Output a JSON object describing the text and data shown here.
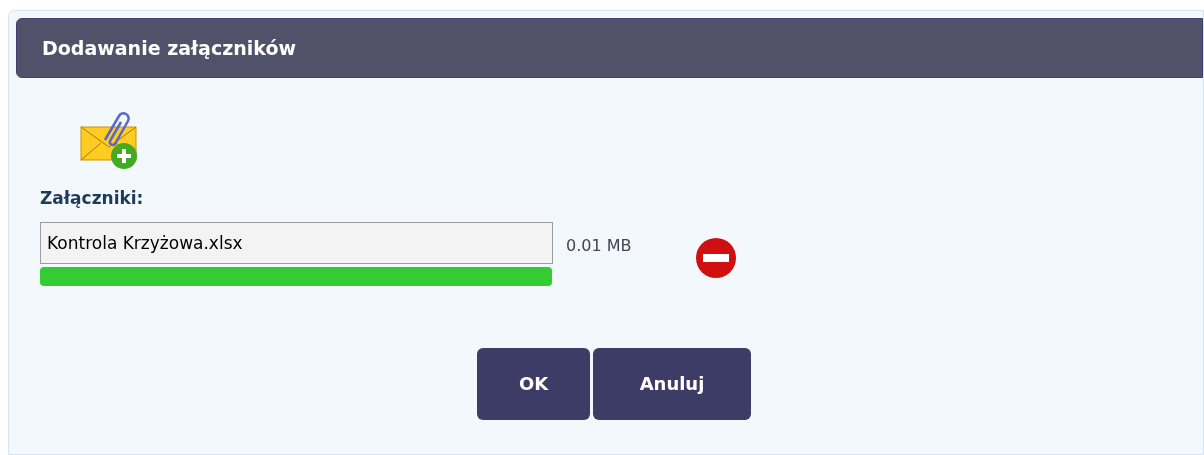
{
  "dialog": {
    "title": "Dodawanie załączników"
  },
  "attachments": {
    "label": "Załączniki:",
    "files": [
      {
        "name": "Kontrola Krzyżowa.xlsx",
        "size": "0.01 MB"
      }
    ]
  },
  "buttons": [
    "OK",
    "Anuluj"
  ]
}
